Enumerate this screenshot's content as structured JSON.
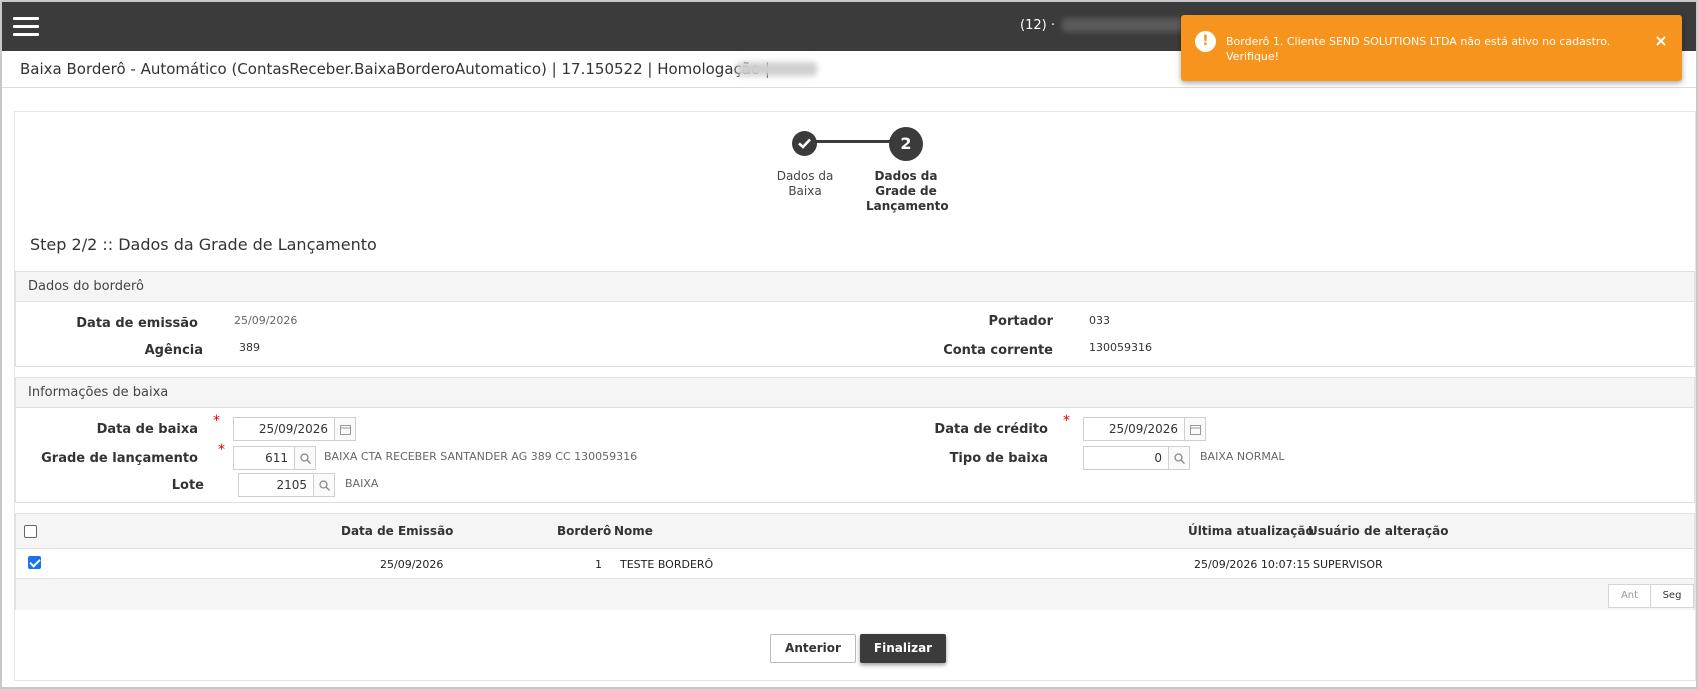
{
  "topbar": {
    "counter": "(12) ·"
  },
  "title": "Baixa Borderô - Automático (ContasReceber.BaixaBorderoAutomatico) | 17.150522 | Homologação |",
  "toast": {
    "message": "Borderô 1. Cliente SEND SOLUTIONS LTDA não está ativo no cadastro. Verifique!",
    "icon": "!",
    "close": "×",
    "color": "#f7941d"
  },
  "stepper": {
    "step1": {
      "label": "Dados da Baixa",
      "icon": "check-icon"
    },
    "step2": {
      "number": "2",
      "label": "Dados da Grade de Lançamento"
    }
  },
  "step_heading": "Step 2/2 :: Dados da Grade de Lançamento",
  "bordero": {
    "title": "Dados do borderô",
    "data_emissao_label": "Data de emissão",
    "data_emissao": "25/09/2026",
    "agencia_label": "Agência",
    "agencia": "389",
    "portador_label": "Portador",
    "portador": "033",
    "conta_label": "Conta corrente",
    "conta": "130059316"
  },
  "baixa": {
    "title": "Informações de baixa",
    "data_baixa_label": "Data de baixa",
    "data_baixa": "25/09/2026",
    "grade_label": "Grade de lançamento",
    "grade": "611",
    "grade_desc": "BAIXA CTA RECEBER SANTANDER AG 389 CC 130059316",
    "lote_label": "Lote",
    "lote": "2105",
    "lote_desc": "BAIXA",
    "data_credito_label": "Data de crédito",
    "data_credito": "25/09/2026",
    "tipo_label": "Tipo de baixa",
    "tipo": "0",
    "tipo_desc": "BAIXA NORMAL",
    "required_mark": "*"
  },
  "grid": {
    "columns": [
      "Data de Emissão",
      "Borderô",
      "Nome",
      "Última atualização",
      "Usuário de alteração"
    ],
    "rows": [
      {
        "checked": true,
        "data_emissao": "25/09/2026",
        "bordero": "1",
        "nome": "TESTE BORDERÔ",
        "ultima_atualizacao": "25/09/2026 10:07:15",
        "usuario": "SUPERVISOR"
      }
    ],
    "pager_prev": "Ant",
    "pager_next": "Seg"
  },
  "buttons": {
    "anterior": "Anterior",
    "finalizar": "Finalizar"
  }
}
